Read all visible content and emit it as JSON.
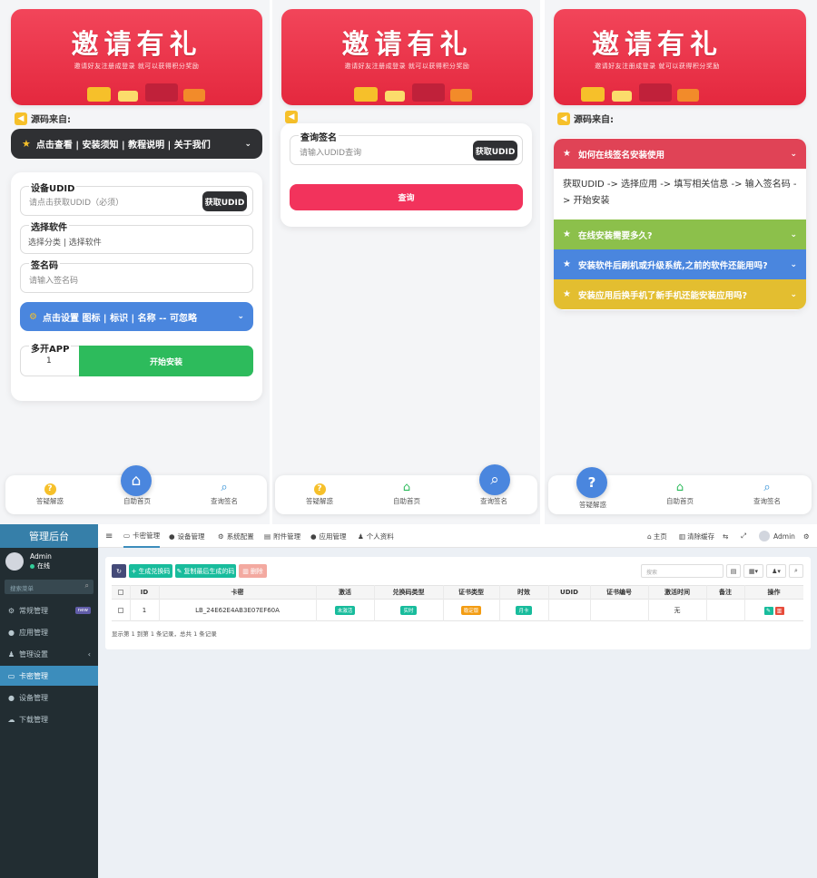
{
  "banner": {
    "title": "邀请有礼",
    "subtitle": "邀请好友注册成登录 就可以获得积分奖励"
  },
  "phone1": {
    "source_label": "源码来自:",
    "menu_bar": "点击查看 | 安装须知 | 教程说明 | 关于我们",
    "udid_label": "设备UDID",
    "udid_placeholder": "请点击获取UDID（必须）",
    "get_udid_button": "获取UDID",
    "software_label": "选择软件",
    "software_placeholder": "选择分类 | 选择软件",
    "signcode_label": "签名码",
    "signcode_placeholder": "请输入签名码",
    "settings_bar": "点击设置 图标 | 标识 | 名称 -- 可忽略",
    "multi_label": "多开APP",
    "multi_value": "1",
    "install_button": "开始安装"
  },
  "phone2": {
    "query_label": "查询签名",
    "query_placeholder": "请输入UDID查询",
    "get_udid_button": "获取UDID",
    "query_button": "查询"
  },
  "phone3": {
    "source_label": "源码来自:",
    "faq": [
      {
        "q": "如何在线签名安装使用",
        "color": "#e04356"
      },
      {
        "q": "在线安装需要多久?",
        "color": "#8cc04b"
      },
      {
        "q": "安装软件后刷机或升级系统,之前的软件还能用吗?",
        "color": "#4a86de"
      },
      {
        "q": "安装应用后换手机了新手机还能安装应用吗?",
        "color": "#e3be30"
      }
    ],
    "faq_answer": "获取UDID -> 选择应用 -> 填写相关信息 -> 输入签名码 -> 开始安装"
  },
  "tabbar": {
    "help": "答疑解惑",
    "home": "自助首页",
    "query": "查询签名"
  },
  "admin": {
    "brand": "管理后台",
    "user": "Admin",
    "status": "在线",
    "search_placeholder": "搜索菜单",
    "menu": [
      "常规管理",
      "应用管理",
      "管理设置",
      "卡密管理",
      "设备管理",
      "下载管理"
    ],
    "menu_badge": "new",
    "tabs": [
      "卡密管理",
      "设备管理",
      "系统配置",
      "附件管理",
      "应用管理",
      "个人资料"
    ],
    "top_right": [
      "主页",
      "清除缓存",
      "Admin"
    ],
    "toolbar": {
      "generate": "生成兑换码",
      "copy": "复制最后生成的码",
      "delete": "删除",
      "search_placeholder": "搜索"
    },
    "columns": [
      "ID",
      "卡密",
      "激活",
      "兑换码类型",
      "证书类型",
      "时效",
      "UDID",
      "证书编号",
      "激活时间",
      "备注",
      "操作"
    ],
    "rows": [
      {
        "id": "1",
        "card": "LB_24E62E4AB3E07EF60A",
        "active": "未激活",
        "type": "实时",
        "cert": "稳定版",
        "period": "月卡",
        "udid": "",
        "cert_no": "",
        "active_time": "无",
        "note": ""
      }
    ],
    "footer": "显示第 1 到第 1 条记录，总共 1 条记录"
  }
}
